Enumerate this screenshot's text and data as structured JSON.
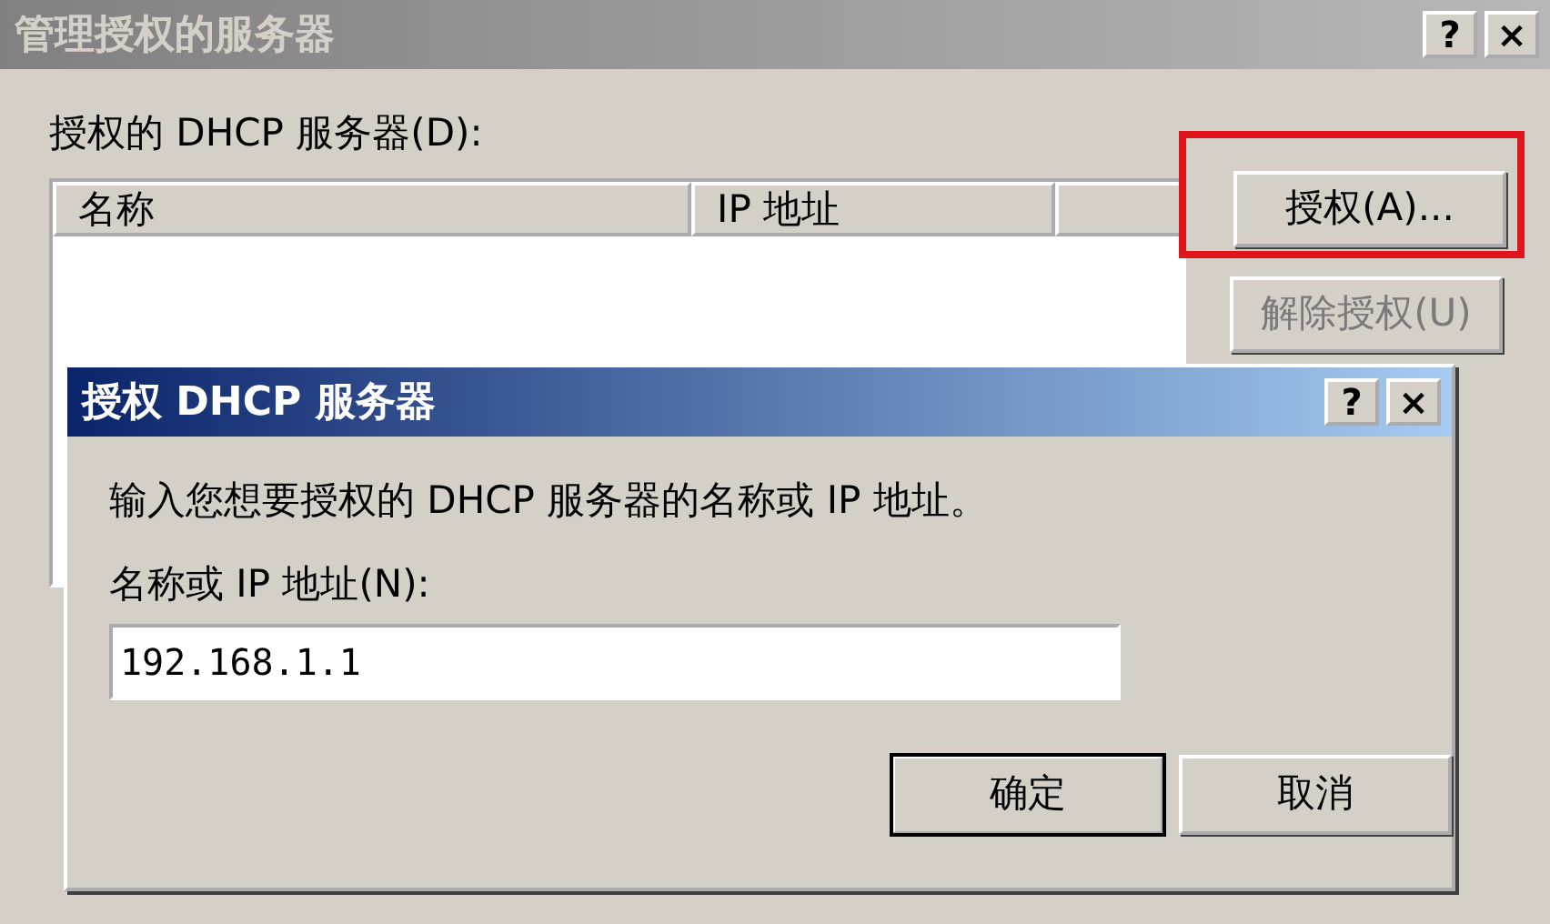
{
  "window": {
    "title": "管理授权的服务器",
    "active": false,
    "title_buttons": [
      "?",
      "×"
    ]
  },
  "list_label": "授权的 DHCP 服务器(D):",
  "list": {
    "columns": [
      "名称",
      "IP 地址"
    ]
  },
  "side_buttons": [
    {
      "label": "授权(A)...",
      "disabled": false,
      "highlighted": true
    },
    {
      "label": "解除授权(U)",
      "disabled": true,
      "highlighted": false
    }
  ],
  "dialog": {
    "title": "授权 DHCP 服务器",
    "active": true,
    "title_buttons": [
      "?",
      "×"
    ],
    "prompt": "输入您想要授权的 DHCP 服务器的名称或 IP 地址。",
    "field_label": "名称或 IP 地址(N):",
    "field_value": "192.168.1.1",
    "buttons": [
      {
        "label": "确定",
        "default": true
      },
      {
        "label": "取消",
        "default": false
      }
    ]
  }
}
